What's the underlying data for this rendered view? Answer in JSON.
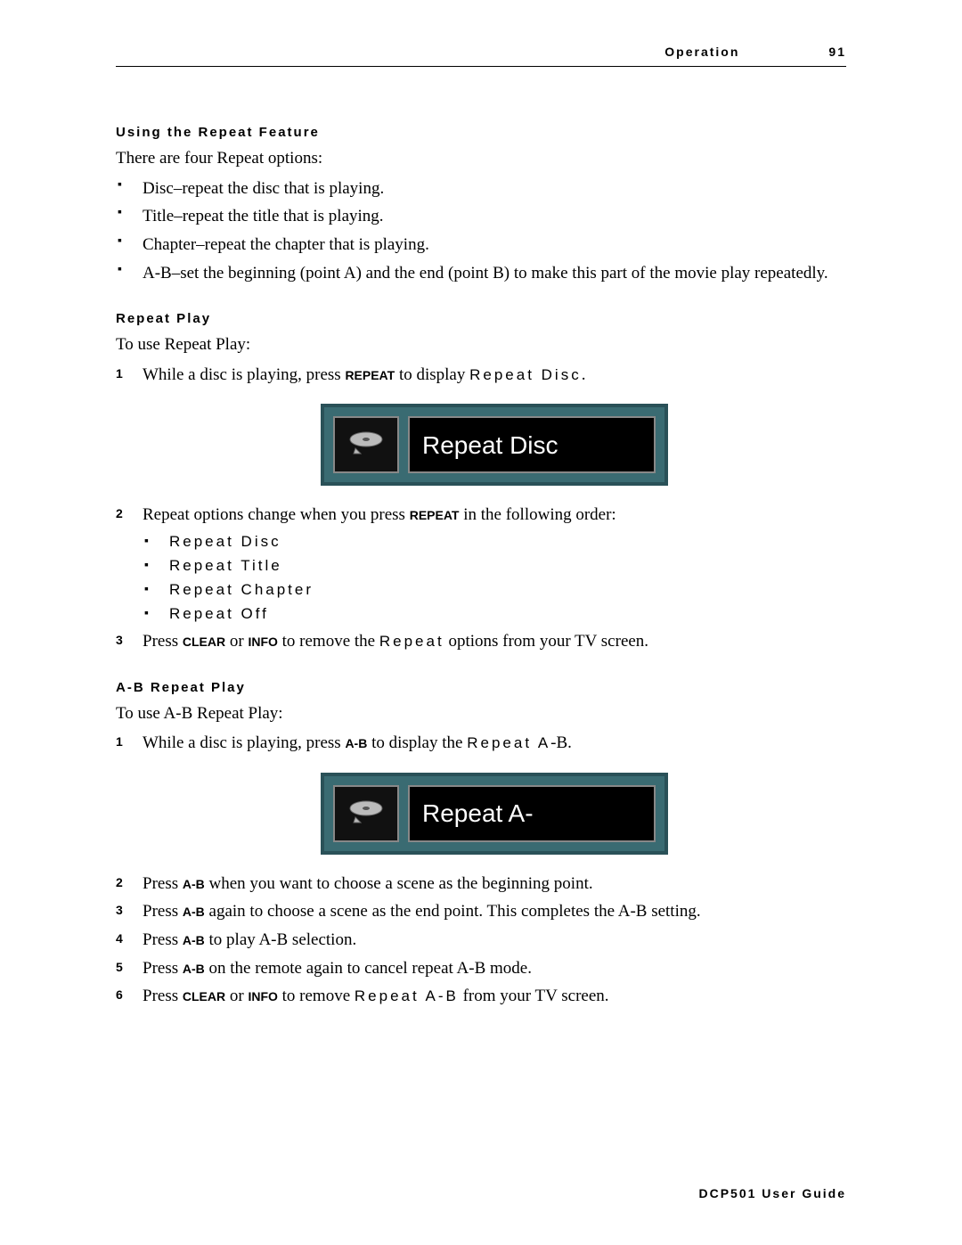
{
  "header": {
    "section": "Operation",
    "page": "91"
  },
  "s1": {
    "heading": "Using the Repeat Feature",
    "intro": "There are four Repeat options:",
    "items": [
      "Disc–repeat the disc that is playing.",
      "Title–repeat the title that is playing.",
      "Chapter–repeat the chapter that is playing.",
      "A-B–set the beginning (point A) and the end (point B) to make this part of the movie play repeatedly."
    ]
  },
  "s2": {
    "heading": "Repeat Play",
    "intro": "To use Repeat Play:",
    "step1_a": "While a disc is playing, press ",
    "step1_key": "REPEAT",
    "step1_b": " to display ",
    "step1_osd": "Repeat Disc",
    "step1_c": ".",
    "figure_label": "Repeat Disc",
    "step2_a": "Repeat options change when you press ",
    "step2_key": "REPEAT",
    "step2_b": " in the following order:",
    "step2_items": [
      "Repeat Disc",
      "Repeat Title",
      "Repeat Chapter",
      "Repeat Off"
    ],
    "step3_a": "Press ",
    "step3_key1": "CLEAR",
    "step3_mid": " or ",
    "step3_key2": "INFO",
    "step3_b": " to remove the ",
    "step3_osd": "Repeat",
    "step3_c": " options from your TV screen."
  },
  "s3": {
    "heading": "A-B Repeat Play",
    "intro": "To use A-B Repeat Play:",
    "step1_a": "While a disc is playing, press ",
    "step1_key": "A-B",
    "step1_b": " to display the ",
    "step1_osd": "Repeat A",
    "step1_c": "-B.",
    "figure_label": "Repeat A-",
    "step2_a": "Press ",
    "step2_key": "A-B",
    "step2_b": " when you want to choose a scene as the beginning point.",
    "step3_a": "Press ",
    "step3_key": "A-B",
    "step3_b": " again to choose a scene as the end point. This completes the A-B setting.",
    "step4_a": "Press ",
    "step4_key": "A-B",
    "step4_b": " to play A-B selection.",
    "step5_a": "Press ",
    "step5_key": "A-B",
    "step5_b": " on the remote again to cancel repeat A-B mode.",
    "step6_a": "Press ",
    "step6_key1": "CLEAR",
    "step6_mid": " or ",
    "step6_key2": "INFO",
    "step6_b": " to remove ",
    "step6_osd": "Repeat A-B",
    "step6_c": " from your TV screen."
  },
  "footer": "DCP501 User Guide"
}
